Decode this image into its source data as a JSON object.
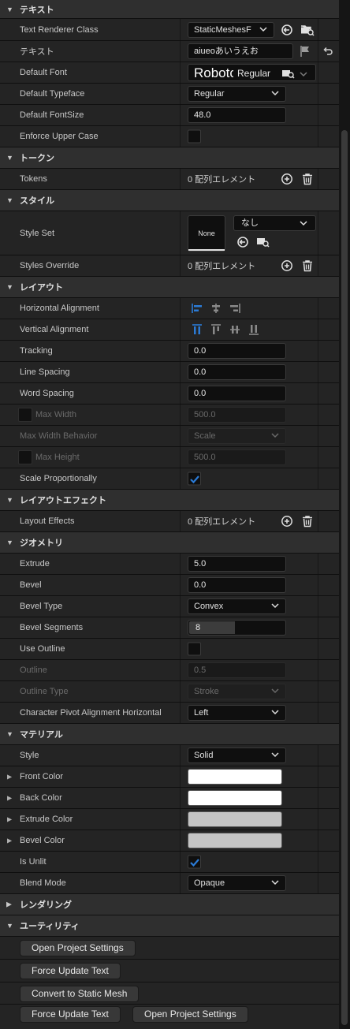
{
  "categories": {
    "text": "テキスト",
    "tokens": "トークン",
    "style": "スタイル",
    "layout": "レイアウト",
    "layout_effects": "レイアウトエフェクト",
    "geometry": "ジオメトリ",
    "material": "マテリアル",
    "rendering": "レンダリング",
    "utility": "ユーティリティ"
  },
  "props": {
    "text_renderer_class": {
      "label": "Text Renderer Class",
      "value": "StaticMeshesF"
    },
    "text": {
      "label": "テキスト",
      "value": "aiueoあいうえお"
    },
    "default_font": {
      "label": "Default Font",
      "font_name": "Robotc",
      "typeface": "Regular"
    },
    "default_typeface": {
      "label": "Default Typeface",
      "value": "Regular"
    },
    "default_fontsize": {
      "label": "Default FontSize",
      "value": "48.0"
    },
    "enforce_upper": {
      "label": "Enforce Upper Case",
      "checked": false
    },
    "tokens": {
      "label": "Tokens",
      "value": "0 配列エレメント"
    },
    "style_set": {
      "label": "Style Set",
      "thumb": "None",
      "value": "なし"
    },
    "styles_override": {
      "label": "Styles Override",
      "value": "0 配列エレメント"
    },
    "h_align": {
      "label": "Horizontal Alignment"
    },
    "v_align": {
      "label": "Vertical Alignment"
    },
    "tracking": {
      "label": "Tracking",
      "value": "0.0"
    },
    "line_spacing": {
      "label": "Line Spacing",
      "value": "0.0"
    },
    "word_spacing": {
      "label": "Word Spacing",
      "value": "0.0"
    },
    "max_width": {
      "label": "Max Width",
      "value": "500.0"
    },
    "max_width_behavior": {
      "label": "Max Width Behavior",
      "value": "Scale"
    },
    "max_height": {
      "label": "Max Height",
      "value": "500.0"
    },
    "scale_proportionally": {
      "label": "Scale Proportionally",
      "checked": true
    },
    "layout_effects": {
      "label": "Layout Effects",
      "value": "0 配列エレメント"
    },
    "extrude": {
      "label": "Extrude",
      "value": "5.0"
    },
    "bevel": {
      "label": "Bevel",
      "value": "0.0"
    },
    "bevel_type": {
      "label": "Bevel Type",
      "value": "Convex"
    },
    "bevel_segments": {
      "label": "Bevel Segments",
      "value": "8"
    },
    "use_outline": {
      "label": "Use Outline",
      "checked": false
    },
    "outline": {
      "label": "Outline",
      "value": "0.5"
    },
    "outline_type": {
      "label": "Outline Type",
      "value": "Stroke"
    },
    "char_pivot": {
      "label": "Character Pivot Alignment Horizontal",
      "value": "Left"
    },
    "style": {
      "label": "Style",
      "value": "Solid"
    },
    "front_color": {
      "label": "Front Color",
      "color": "#ffffff"
    },
    "back_color": {
      "label": "Back Color",
      "color": "#ffffff"
    },
    "extrude_color": {
      "label": "Extrude Color",
      "color": "#c4c4c4"
    },
    "bevel_color": {
      "label": "Bevel Color",
      "color": "#c4c4c4"
    },
    "is_unlit": {
      "label": "Is Unlit",
      "checked": true
    },
    "blend_mode": {
      "label": "Blend Mode",
      "value": "Opaque"
    }
  },
  "buttons": {
    "open_project_settings": "Open Project Settings",
    "force_update_text": "Force Update Text",
    "convert_to_static_mesh": "Convert to Static Mesh",
    "force_update_text_2": "Force Update Text",
    "open_project_settings_2": "Open Project Settings"
  },
  "colors": {
    "accent": "#2b7bd6",
    "panel_bg": "#242424",
    "category_bg": "#2f2f2f"
  }
}
